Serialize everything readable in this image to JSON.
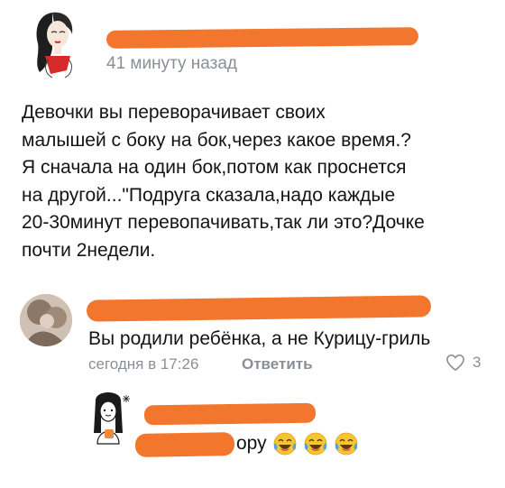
{
  "post": {
    "timestamp": "41 минуту назад",
    "text": "Девочки вы переворачивает своих\nмалышей с боку на бок,через какое время.?\nЯ сначала на один бок,потом как проснется\nна другой...\"Подруга сказала,надо каждые\n20-30минут перевопачивать,так ли это?Дочке\nпочти 2недели."
  },
  "comment1": {
    "text": "Вы родили ребёнка, а не Курицу-гриль",
    "time": "сегодня в 17:26",
    "reply_label": "Ответить",
    "likes": "3"
  },
  "comment2": {
    "text": "ору",
    "emojis": [
      "face-with-tears-of-joy",
      "face-with-tears-of-joy",
      "face-with-tears-of-joy"
    ]
  },
  "colors": {
    "redaction": "#f2762e",
    "muted": "#8a8f96",
    "text": "#141414"
  }
}
